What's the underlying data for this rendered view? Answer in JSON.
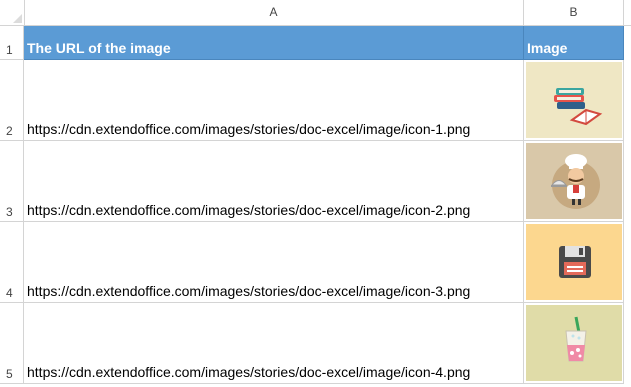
{
  "columns": {
    "a": "A",
    "b": "B"
  },
  "rows": {
    "r1": "1",
    "r2": "2",
    "r3": "3",
    "r4": "4",
    "r5": "5"
  },
  "header": {
    "url": "The URL of the image",
    "image": "Image"
  },
  "data": [
    {
      "url": "https://cdn.extendoffice.com/images/stories/doc-excel/image/icon-1.png",
      "icon": "books-icon",
      "bg": "#efe7c4"
    },
    {
      "url": "https://cdn.extendoffice.com/images/stories/doc-excel/image/icon-2.png",
      "icon": "chef-icon",
      "bg": "#d9c8a9"
    },
    {
      "url": "https://cdn.extendoffice.com/images/stories/doc-excel/image/icon-3.png",
      "icon": "floppy-disk-icon",
      "bg": "#fcd78f"
    },
    {
      "url": "https://cdn.extendoffice.com/images/stories/doc-excel/image/icon-4.png",
      "icon": "drink-glass-icon",
      "bg": "#e0dca8"
    }
  ],
  "colors": {
    "header_bg": "#5b9bd5",
    "grid": "#d4d4d4"
  }
}
